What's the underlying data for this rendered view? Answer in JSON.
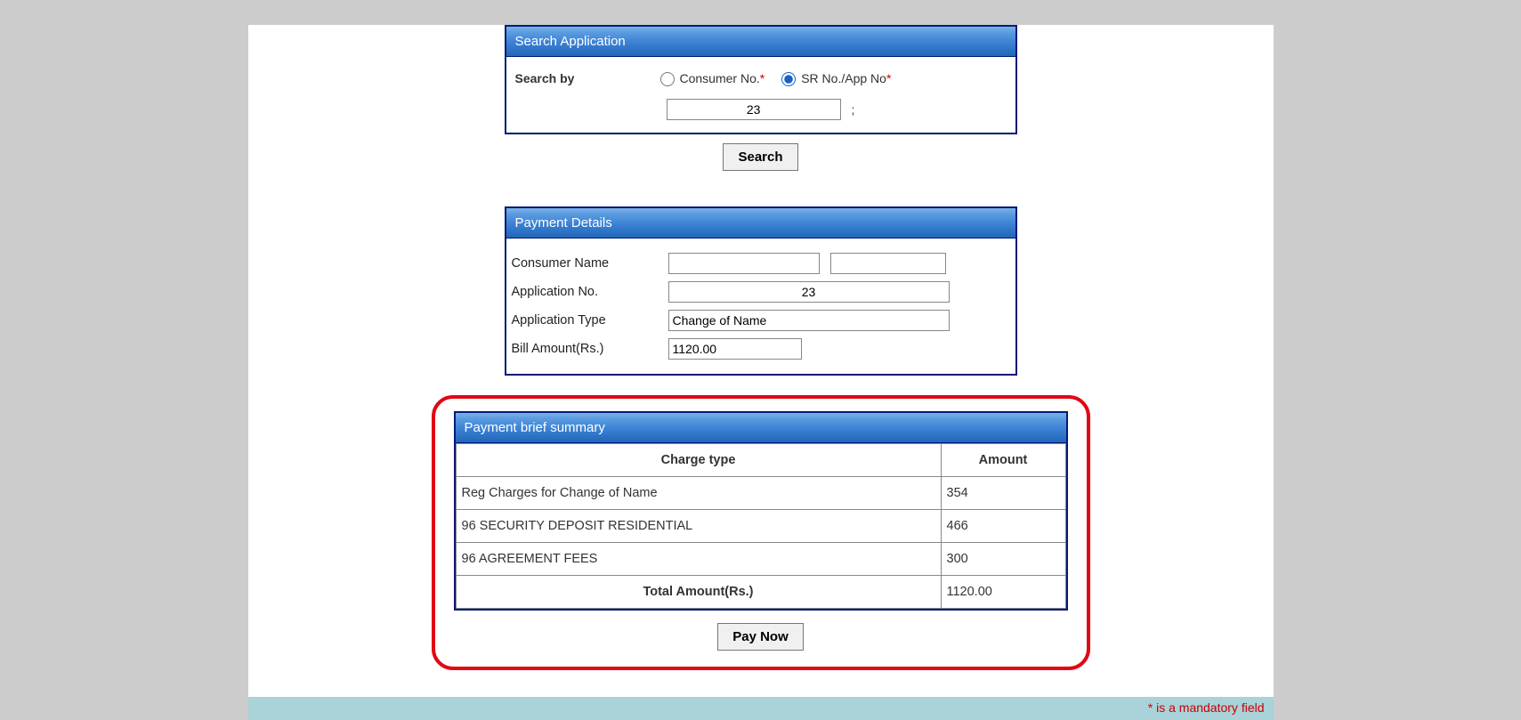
{
  "search": {
    "title": "Search Application",
    "label": "Search by",
    "radio_consumer": "Consumer No.",
    "radio_sr": "SR No./App No",
    "asterisk": "*",
    "input_value": "23",
    "semicolon": ";",
    "button": "Search"
  },
  "details": {
    "title": "Payment Details",
    "consumer_name_label": "Consumer Name",
    "consumer_name1": "",
    "consumer_name2": "",
    "app_no_label": "Application No.",
    "app_no_value": "23",
    "app_type_label": "Application Type",
    "app_type_value": "Change of Name",
    "bill_amt_label": "Bill Amount(Rs.)",
    "bill_amt_value": "1120.00"
  },
  "summary": {
    "title": "Payment brief summary",
    "col_charge": "Charge type",
    "col_amount": "Amount",
    "rows": [
      {
        "charge": "Reg Charges for Change of Name",
        "amount": "354"
      },
      {
        "charge": "96 SECURITY DEPOSIT RESIDENTIAL",
        "amount": "466"
      },
      {
        "charge": "96 AGREEMENT FEES",
        "amount": "300"
      }
    ],
    "total_label": "Total Amount(Rs.)",
    "total_value": "1120.00",
    "paynow": "Pay Now"
  },
  "footer": {
    "mandatory": "* is a mandatory field"
  }
}
